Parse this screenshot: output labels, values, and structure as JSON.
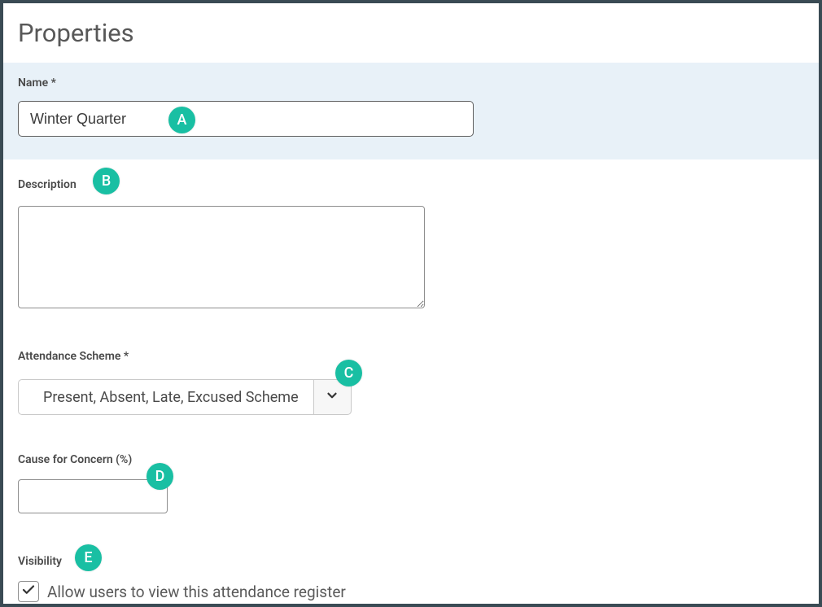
{
  "title": "Properties",
  "fields": {
    "name": {
      "label": "Name *",
      "value": "Winter Quarter",
      "badge": "A"
    },
    "description": {
      "label": "Description",
      "value": "",
      "badge": "B"
    },
    "scheme": {
      "label": "Attendance Scheme *",
      "selected": "Present, Absent, Late, Excused Scheme",
      "badge": "C"
    },
    "concern": {
      "label": "Cause for Concern (%)",
      "value": "",
      "badge": "D"
    },
    "visibility": {
      "label": "Visibility",
      "checkbox_label": "Allow users to view this attendance register",
      "checked": true,
      "badge": "E"
    }
  },
  "colors": {
    "badge_bg": "#19bfa3",
    "banner_bg": "#e8f1f8",
    "frame_border": "#3a4b54"
  }
}
